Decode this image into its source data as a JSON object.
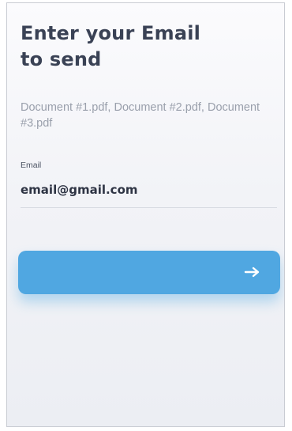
{
  "header": {
    "title_line1": "Enter your Email",
    "title_line2": "to send"
  },
  "documents": {
    "text": "Document #1.pdf, Document #2.pdf, Document #3.pdf"
  },
  "email_field": {
    "label": "Email",
    "value": "email@gmail.com"
  },
  "send_button": {
    "icon": "arrow-right-icon",
    "color": "#50a7e1"
  },
  "colors": {
    "title": "#3a4255",
    "muted_text": "#9aa0ac",
    "accent": "#50a7e1"
  }
}
